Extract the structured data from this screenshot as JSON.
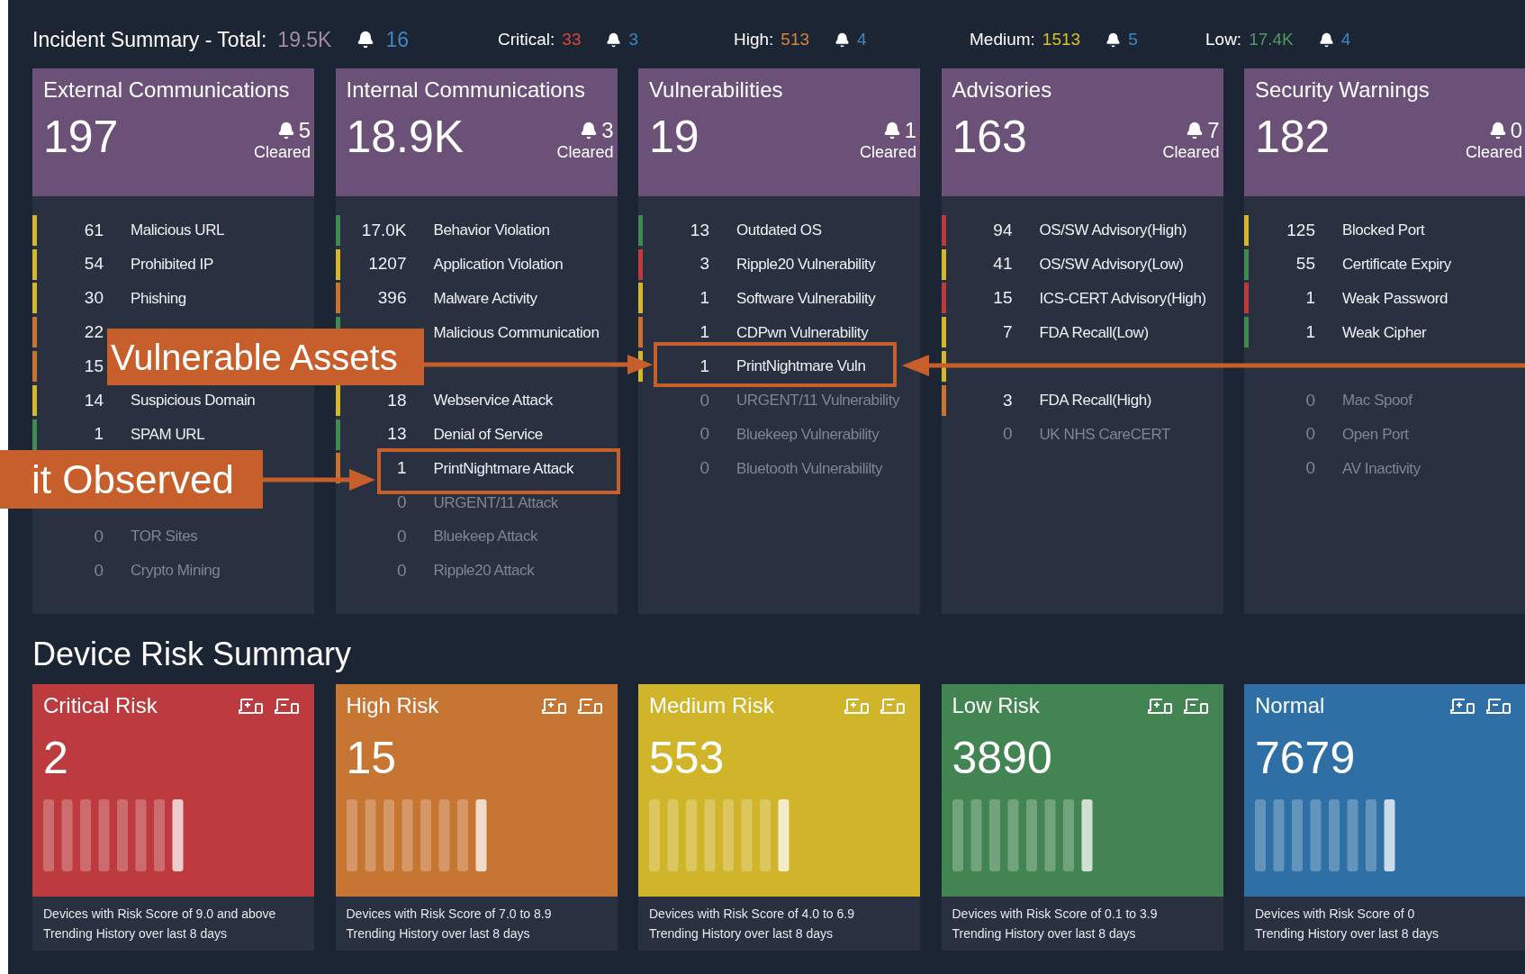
{
  "header": {
    "title": "Incident Summary - Total:",
    "total": "19.5K",
    "total_alerts": "16",
    "levels": [
      {
        "label": "Critical:",
        "value": "33",
        "color": "#d9463f",
        "alerts": "3"
      },
      {
        "label": "High:",
        "value": "513",
        "color": "#d8843a",
        "alerts": "4"
      },
      {
        "label": "Medium:",
        "value": "1513",
        "color": "#d9c12e",
        "alerts": "5"
      },
      {
        "label": "Low:",
        "value": "17.4K",
        "color": "#4f9a5c",
        "alerts": "4"
      }
    ]
  },
  "incident_cards": [
    {
      "title": "External Communications",
      "count": "197",
      "alerts": "5",
      "alerts_label": "Cleared",
      "rows": [
        {
          "count": "61",
          "name": "Malicious URL",
          "color": "#d4b82a",
          "disabled": false
        },
        {
          "count": "54",
          "name": "Prohibited IP",
          "color": "#d4b82a",
          "disabled": false
        },
        {
          "count": "30",
          "name": "Phishing",
          "color": "#d4b82a",
          "disabled": false
        },
        {
          "count": "22",
          "color": "#c8742f",
          "disabled": false
        },
        {
          "count": "15",
          "color": "#c8742f",
          "disabled": false
        },
        {
          "count": "14",
          "name": "Suspicious Domain",
          "color": "#d4b82a",
          "disabled": false
        },
        {
          "count": "1",
          "name": "SPAM URL",
          "color": "#3f8a4f",
          "disabled": false
        },
        {},
        {},
        {
          "count": "0",
          "name": "TOR Sites",
          "disabled": true
        },
        {
          "count": "0",
          "name": "Crypto Mining",
          "disabled": true
        }
      ]
    },
    {
      "title": "Internal Communications",
      "count": "18.9K",
      "alerts": "3",
      "alerts_label": "Cleared",
      "rows": [
        {
          "count": "17.0K",
          "name": "Behavior Violation",
          "color": "#3f8a4f",
          "disabled": false
        },
        {
          "count": "1207",
          "name": "Application Violation",
          "color": "#d4b82a",
          "disabled": false
        },
        {
          "count": "396",
          "name": "Malware Activity",
          "color": "#c8742f",
          "disabled": false
        },
        {
          "name": "Malicious Communication",
          "color": "#3f8a4f",
          "disabled": false
        },
        {},
        {
          "count": "18",
          "name": "Webservice Attack",
          "color": "#d4b82a",
          "disabled": false
        },
        {
          "count": "13",
          "name": "Denial of Service",
          "color": "#3f8a4f",
          "disabled": false
        },
        {
          "count": "1",
          "name": "PrintNightmare Attack",
          "color": "#c8742f",
          "disabled": false
        },
        {
          "count": "0",
          "name": "URGENT/11 Attack",
          "disabled": true
        },
        {
          "count": "0",
          "name": "Bluekeep Attack",
          "disabled": true
        },
        {
          "count": "0",
          "name": "Ripple20 Attack",
          "disabled": true
        }
      ]
    },
    {
      "title": "Vulnerabilities",
      "count": "19",
      "alerts": "1",
      "alerts_label": "Cleared",
      "rows": [
        {
          "count": "13",
          "name": "Outdated OS",
          "color": "#3f8a4f",
          "disabled": false
        },
        {
          "count": "3",
          "name": "Ripple20 Vulnerability",
          "color": "#c0393d",
          "disabled": false
        },
        {
          "count": "1",
          "name": "Software Vulnerability",
          "color": "#d4b82a",
          "disabled": false
        },
        {
          "count": "1",
          "name": "CDPwn Vulnerability",
          "color": "#c8742f",
          "disabled": false
        },
        {
          "count": "1",
          "name": "PrintNightmare Vuln",
          "color": "#d4b82a",
          "disabled": false
        },
        {
          "count": "0",
          "name": "URGENT/11 Vulnerability",
          "disabled": true
        },
        {
          "count": "0",
          "name": "Bluekeep Vulnerability",
          "disabled": true
        },
        {
          "count": "0",
          "name": "Bluetooth Vulnerabililty",
          "disabled": true
        }
      ]
    },
    {
      "title": "Advisories",
      "count": "163",
      "alerts": "7",
      "alerts_label": "Cleared",
      "rows": [
        {
          "count": "94",
          "name": "OS/SW Advisory(High)",
          "color": "#c0393d",
          "disabled": false
        },
        {
          "count": "41",
          "name": "OS/SW Advisory(Low)",
          "color": "#d4b82a",
          "disabled": false
        },
        {
          "count": "15",
          "name": "ICS-CERT Advisory(High)",
          "color": "#c0393d",
          "disabled": false
        },
        {
          "count": "7",
          "name": "FDA Recall(Low)",
          "color": "#d4b82a",
          "disabled": false
        },
        {
          "color": "#d4b82a"
        },
        {
          "count": "3",
          "name": "FDA Recall(High)",
          "color": "#c8742f",
          "disabled": false
        },
        {
          "count": "0",
          "name": "UK NHS CareCERT",
          "disabled": true
        }
      ]
    },
    {
      "title": "Security Warnings",
      "count": "182",
      "alerts": "0",
      "alerts_label": "Cleared",
      "rows": [
        {
          "count": "125",
          "name": "Blocked Port",
          "color": "#d4b82a",
          "disabled": false
        },
        {
          "count": "55",
          "name": "Certificate Expiry",
          "color": "#3f8a4f",
          "disabled": false
        },
        {
          "count": "1",
          "name": "Weak Password",
          "color": "#c0393d",
          "disabled": false
        },
        {
          "count": "1",
          "name": "Weak Cipher",
          "color": "#3f8a4f",
          "disabled": false
        },
        {},
        {
          "count": "0",
          "name": "Mac Spoof",
          "disabled": true
        },
        {
          "count": "0",
          "name": "Open Port",
          "disabled": true
        },
        {
          "count": "0",
          "name": "AV Inactivity",
          "disabled": true
        }
      ]
    }
  ],
  "device_risk": {
    "title": "Device Risk Summary",
    "cards": [
      {
        "title": "Critical Risk",
        "count": "2",
        "color": "#bd3b3f",
        "description": "Devices with Risk Score of 9.0 and above",
        "trend_label": "Trending History over last 8 days"
      },
      {
        "title": "High Risk",
        "count": "15",
        "color": "#c77533",
        "description": "Devices with Risk Score of 7.0 to 8.9",
        "trend_label": "Trending History over last 8 days"
      },
      {
        "title": "Medium Risk",
        "count": "553",
        "color": "#d0b429",
        "description": "Devices with Risk Score of 4.0 to 6.9",
        "trend_label": "Trending History over last 8 days"
      },
      {
        "title": "Low Risk",
        "count": "3890",
        "color": "#428552",
        "description": "Devices with Risk Score of 0.1 to 3.9",
        "trend_label": "Trending History over last 8 days"
      },
      {
        "title": "Normal",
        "count": "7679",
        "color": "#2e70a6",
        "description": "Devices with Risk Score of 0",
        "trend_label": "Trending History over last 8 days"
      }
    ]
  },
  "callouts": [
    {
      "text": "Vulnerable Assets"
    },
    {
      "text": "it Observed"
    }
  ]
}
